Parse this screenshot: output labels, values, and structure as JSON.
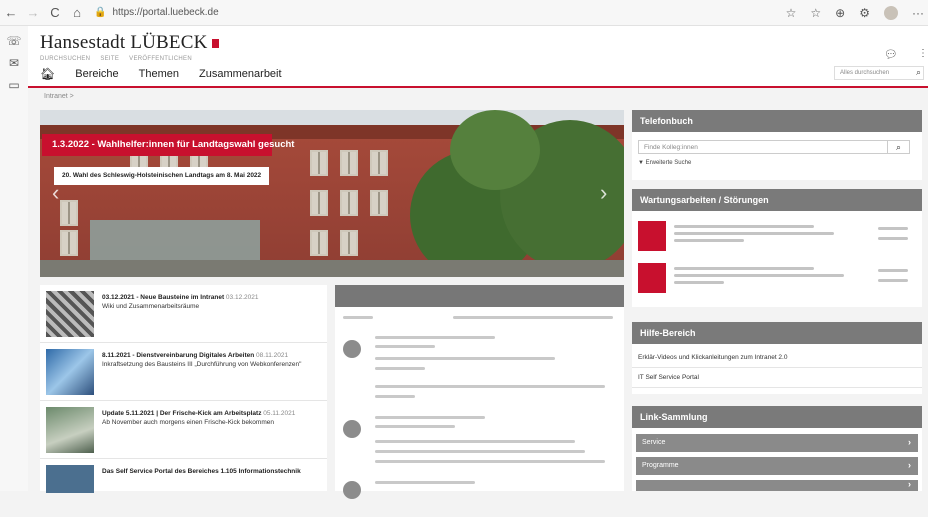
{
  "browser": {
    "url": "https://portal.luebeck.de",
    "back": "←",
    "forward": "→",
    "reload": "C",
    "home": "⌂"
  },
  "header": {
    "logo_text": "Hansestadt LÜBECK",
    "small_links": [
      "DURCHSUCHEN",
      "SEITE",
      "VERÖFFENTLICHEN"
    ],
    "nav": [
      "Bereiche",
      "Themen",
      "Zusammenarbeit"
    ],
    "search_placeholder": "Alles durchsuchen"
  },
  "breadcrumb": "Intranet >",
  "hero": {
    "headline": "1.3.2022 - Wahlhelfer:innen für Landtagswahl gesucht",
    "subline": "20. Wahl des Schleswig-Holsteinischen Landtags am 8. Mai 2022"
  },
  "news": [
    {
      "title": "03.12.2021 - Neue Bausteine im Intranet",
      "date": "03.12.2021",
      "text": "Wiki und Zusammenarbeitsräume"
    },
    {
      "title": "8.11.2021 - Dienstvereinbarung Digitales Arbeiten",
      "date": "08.11.2021",
      "text": "Inkraftsetzung des Bausteins III „Durchführung von Webkonferenzen\""
    },
    {
      "title": "Update 5.11.2021 | Der Frische-Kick am Arbeitsplatz",
      "date": "05.11.2021",
      "text": "Ab November auch morgens einen Frische-Kick bekommen"
    },
    {
      "title": "Das Self Service Portal des Bereiches 1.105 Informationstechnik",
      "date": "",
      "text": ""
    }
  ],
  "right": {
    "telefonbuch": {
      "title": "Telefonbuch",
      "placeholder": "Finde Kolleg:innen",
      "advanced": "Erweiterte Suche"
    },
    "wartung": {
      "title": "Wartungsarbeiten / Störungen"
    },
    "hilfe": {
      "title": "Hilfe-Bereich",
      "items": [
        "Erklär-Videos und Klickanleitungen zum Intranet 2.0",
        "IT Self Service Portal"
      ]
    },
    "links": {
      "title": "Link-Sammlung",
      "items": [
        "Service",
        "Programme",
        ""
      ]
    }
  },
  "colors": {
    "brand_red": "#c8102e",
    "panel_grey": "#7a7a7a"
  }
}
